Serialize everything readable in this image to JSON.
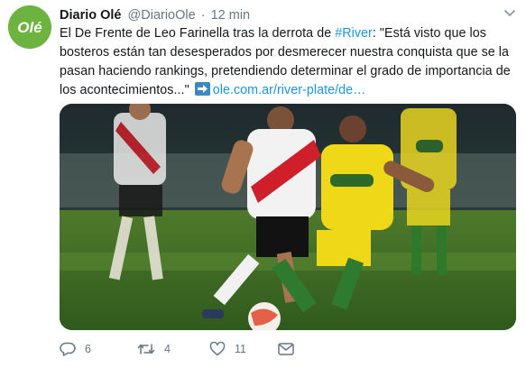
{
  "tweet": {
    "display_name": "Diario Olé",
    "handle": "@DiarioOle",
    "separator": "·",
    "time": "12 min",
    "avatar_text": "Olé",
    "text_before": "El De Frente de Leo Farinella tras la derrota de ",
    "hashtag": "#River",
    "text_after": ": \"Está visto que los bosteros están tan desesperados por desmerecer nuestra conquista que se la pasan haciendo rankings, pretendiendo determinar el grado de importancia de los acontecimientos...\"",
    "link_text": "ole.com.ar/river-plate/de…",
    "emoji": "right-arrow-emoji"
  },
  "actions": {
    "reply_count": "6",
    "retweet_count": "4",
    "like_count": "11"
  },
  "colors": {
    "brand_green": "#6cb33f",
    "link_blue": "#1b95e0",
    "meta_gray": "#657786"
  }
}
